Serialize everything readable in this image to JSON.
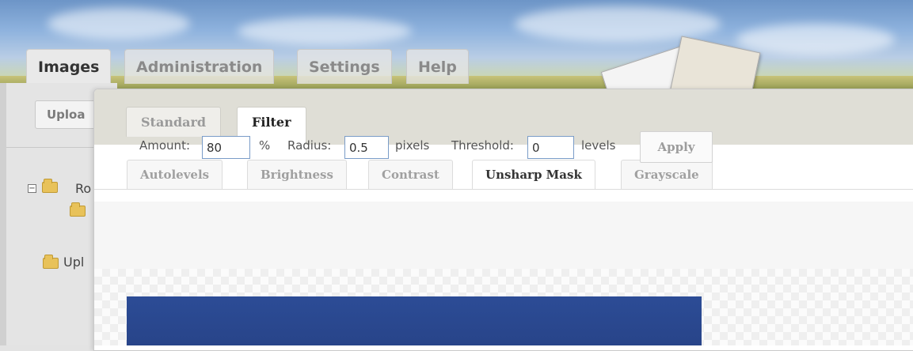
{
  "main_tabs": [
    {
      "label": "Images",
      "active": true
    },
    {
      "label": "Administration",
      "active": false
    },
    {
      "label": "Settings",
      "active": false
    },
    {
      "label": "Help",
      "active": false
    }
  ],
  "left_panel": {
    "upload_button_label": "Uploa",
    "tree_toggle": "−",
    "tree_root_label": "Ro",
    "upload_link_label": "Upl"
  },
  "dialog": {
    "tabs": [
      {
        "label": "Standard",
        "active": false
      },
      {
        "label": "Filter",
        "active": true
      }
    ],
    "filter_tabs": [
      {
        "label": "Autolevels",
        "active": false
      },
      {
        "label": "Brightness",
        "active": false
      },
      {
        "label": "Contrast",
        "active": false
      },
      {
        "label": "Unsharp Mask",
        "active": true
      },
      {
        "label": "Grayscale",
        "active": false
      }
    ],
    "options": {
      "amount_label": "Amount:",
      "amount_value": "80",
      "amount_unit": "%",
      "radius_label": "Radius:",
      "radius_value": "0.5",
      "radius_unit": "pixels",
      "threshold_label": "Threshold:",
      "threshold_value": "0",
      "threshold_unit": "levels",
      "apply_label": "Apply"
    }
  },
  "colors": {
    "preview_image": "#2c4c96",
    "dialog_tabbar": "#dfded6",
    "input_border": "#7a9cc8"
  }
}
